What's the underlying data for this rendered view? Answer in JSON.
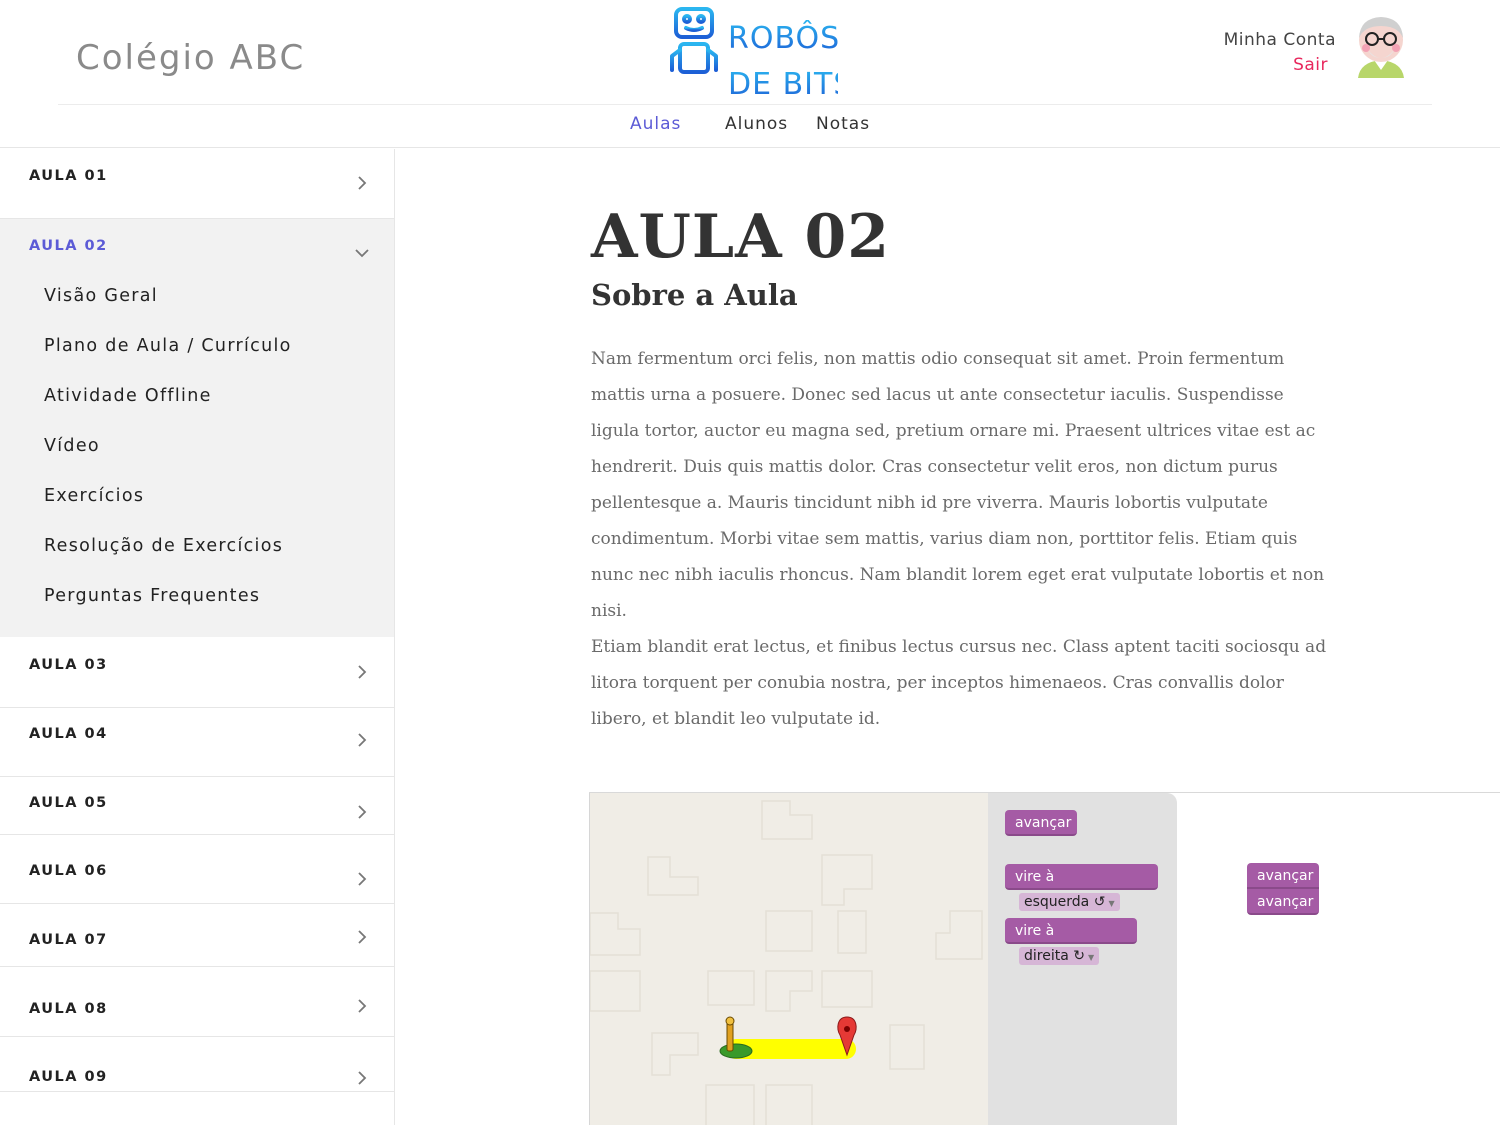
{
  "header": {
    "school_name": "Colégio ABC",
    "logo_text_line1": "ROBÔS",
    "logo_text_line2": "DE BITS",
    "account_label": "Minha Conta",
    "logout_label": "Sair",
    "nav": [
      {
        "label": "Aulas",
        "active": true
      },
      {
        "label": "Alunos",
        "active": false
      },
      {
        "label": "Notas",
        "active": false
      }
    ]
  },
  "sidebar": {
    "lessons": [
      {
        "label": "AULA 01",
        "expanded": false
      },
      {
        "label": "AULA 02",
        "expanded": true
      },
      {
        "label": "AULA 03",
        "expanded": false
      },
      {
        "label": "AULA 04",
        "expanded": false
      },
      {
        "label": "AULA 05",
        "expanded": false
      },
      {
        "label": "AULA 06",
        "expanded": false
      },
      {
        "label": "AULA 07",
        "expanded": false
      },
      {
        "label": "AULA 08",
        "expanded": false
      },
      {
        "label": "AULA 09",
        "expanded": false
      }
    ],
    "subitems": [
      "Visão Geral",
      "Plano de Aula / Currículo",
      "Atividade Offline",
      "Vídeo",
      "Exercícios",
      "Resolução de Exercícios",
      "Perguntas Frequentes"
    ]
  },
  "main": {
    "title": "AULA 02",
    "subtitle": "Sobre a Aula",
    "paragraphs": [
      "Nam fermentum orci felis, non mattis odio consequat sit amet. Proin fermentum mattis urna a posuere. Donec sed lacus ut ante consectetur iaculis. Suspendisse ligula tortor, auctor eu magna sed, pretium ornare mi. Praesent ultrices vitae est ac hendrerit. Duis quis mattis dolor. Cras consectetur velit eros, non dictum purus pellentesque a. Mauris tincidunt nibh id pre viverra. Mauris lobortis vulputate condimentum. Morbi vitae sem mattis, varius diam non, porttitor felis. Etiam quis nunc nec nibh iaculis rhoncus. Nam blandit lorem eget erat vulputate lobortis et non nisi.",
      "Etiam blandit erat lectus, et finibus lectus cursus nec. Class aptent taciti sociosqu ad litora torquent per conubia nostra, per inceptos himenaeos. Cras convallis dolor libero, et blandit leo vulputate id."
    ]
  },
  "game": {
    "toolbox": {
      "forward": "avançar",
      "turn_prefix": "vire à",
      "turn_left": "esquerda ↺",
      "turn_right": "direita ↻"
    },
    "workspace_blocks": [
      "avançar",
      "avançar"
    ]
  },
  "colors": {
    "accent": "#5c5bd6",
    "logout": "#e8285d",
    "block": "#a55ba5",
    "path": "#ffff00"
  }
}
